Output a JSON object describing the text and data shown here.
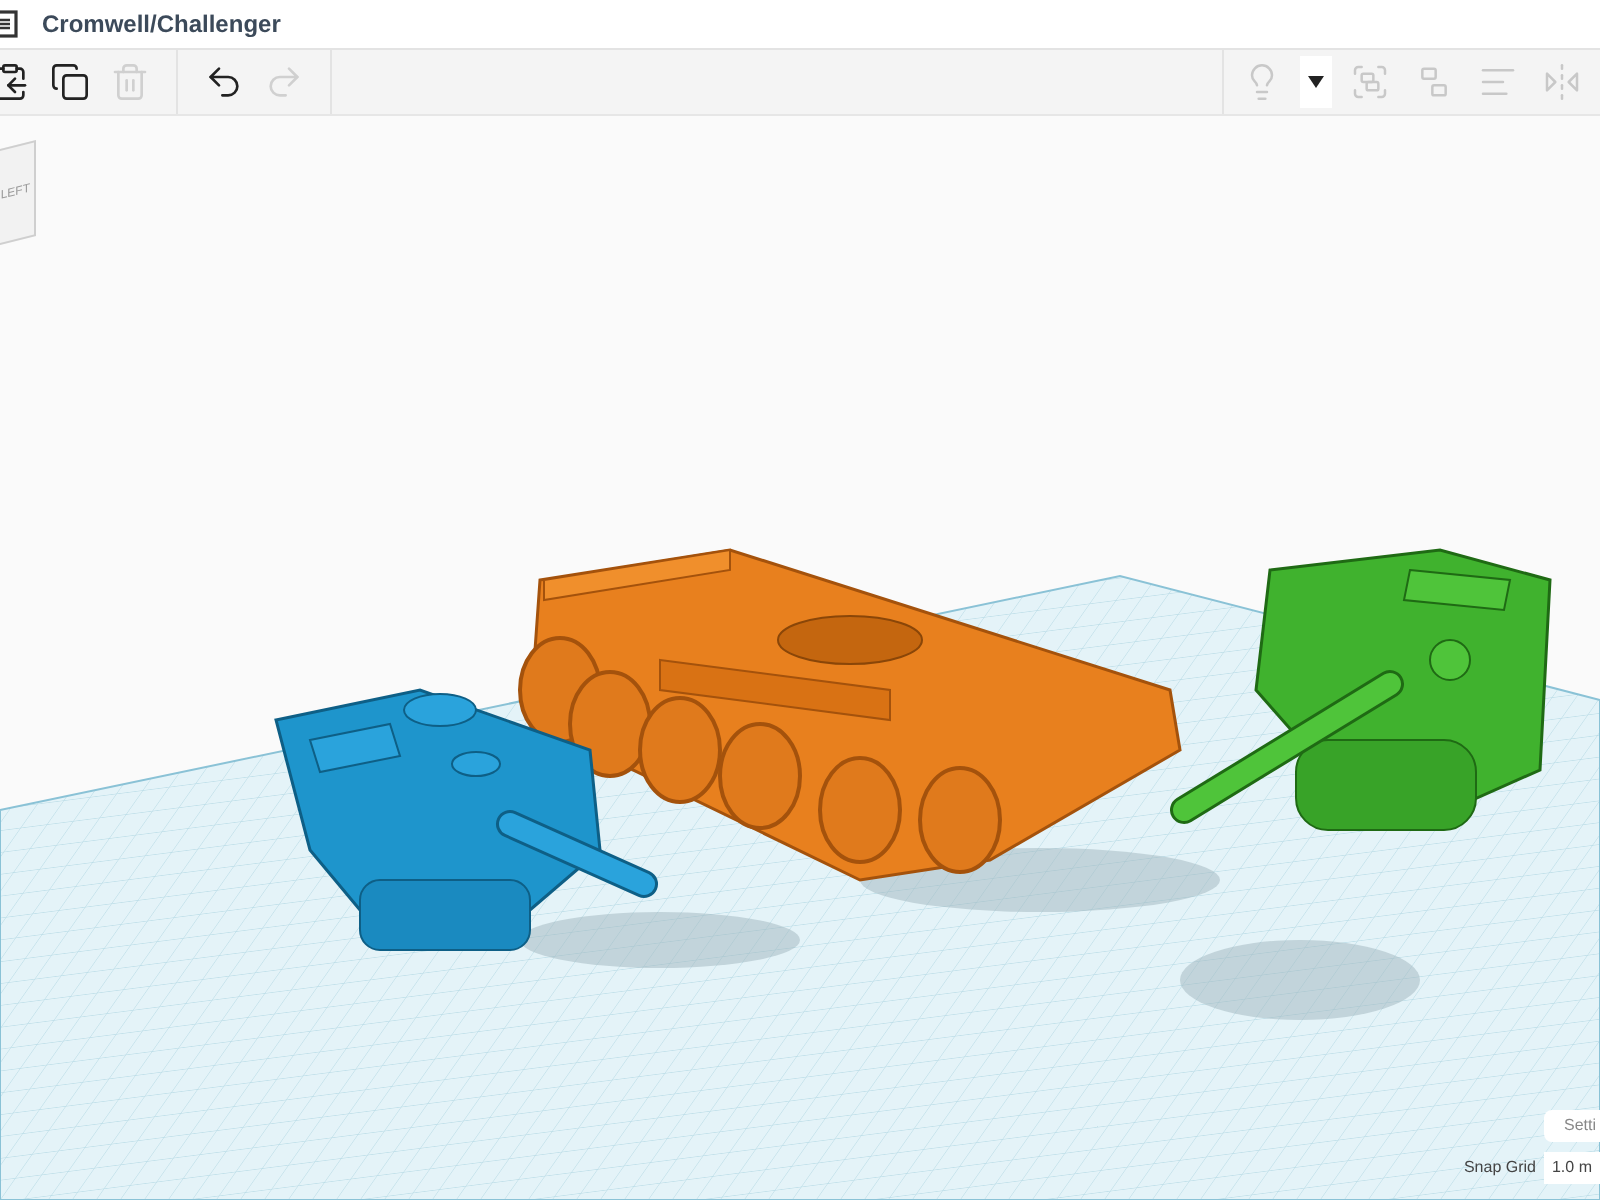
{
  "window": {
    "title": "Cromwell/Challenger"
  },
  "toolbar_left": [
    {
      "disabled": false
    },
    {
      "disabled": false
    },
    {
      "disabled": true
    },
    {
      "disabled": false
    },
    {
      "disabled": true
    }
  ],
  "toolbar_right": [
    {
      "disabled": true
    },
    {
      "disabled": false
    },
    {
      "disabled": true
    },
    {
      "disabled": true
    },
    {
      "disabled": true
    },
    {
      "disabled": true
    }
  ],
  "view_cube": {
    "label": "LEFT"
  },
  "settings_button": {
    "label": "Setti"
  },
  "snap_grid": {
    "label": "Snap Grid",
    "value": "1.0 m"
  }
}
